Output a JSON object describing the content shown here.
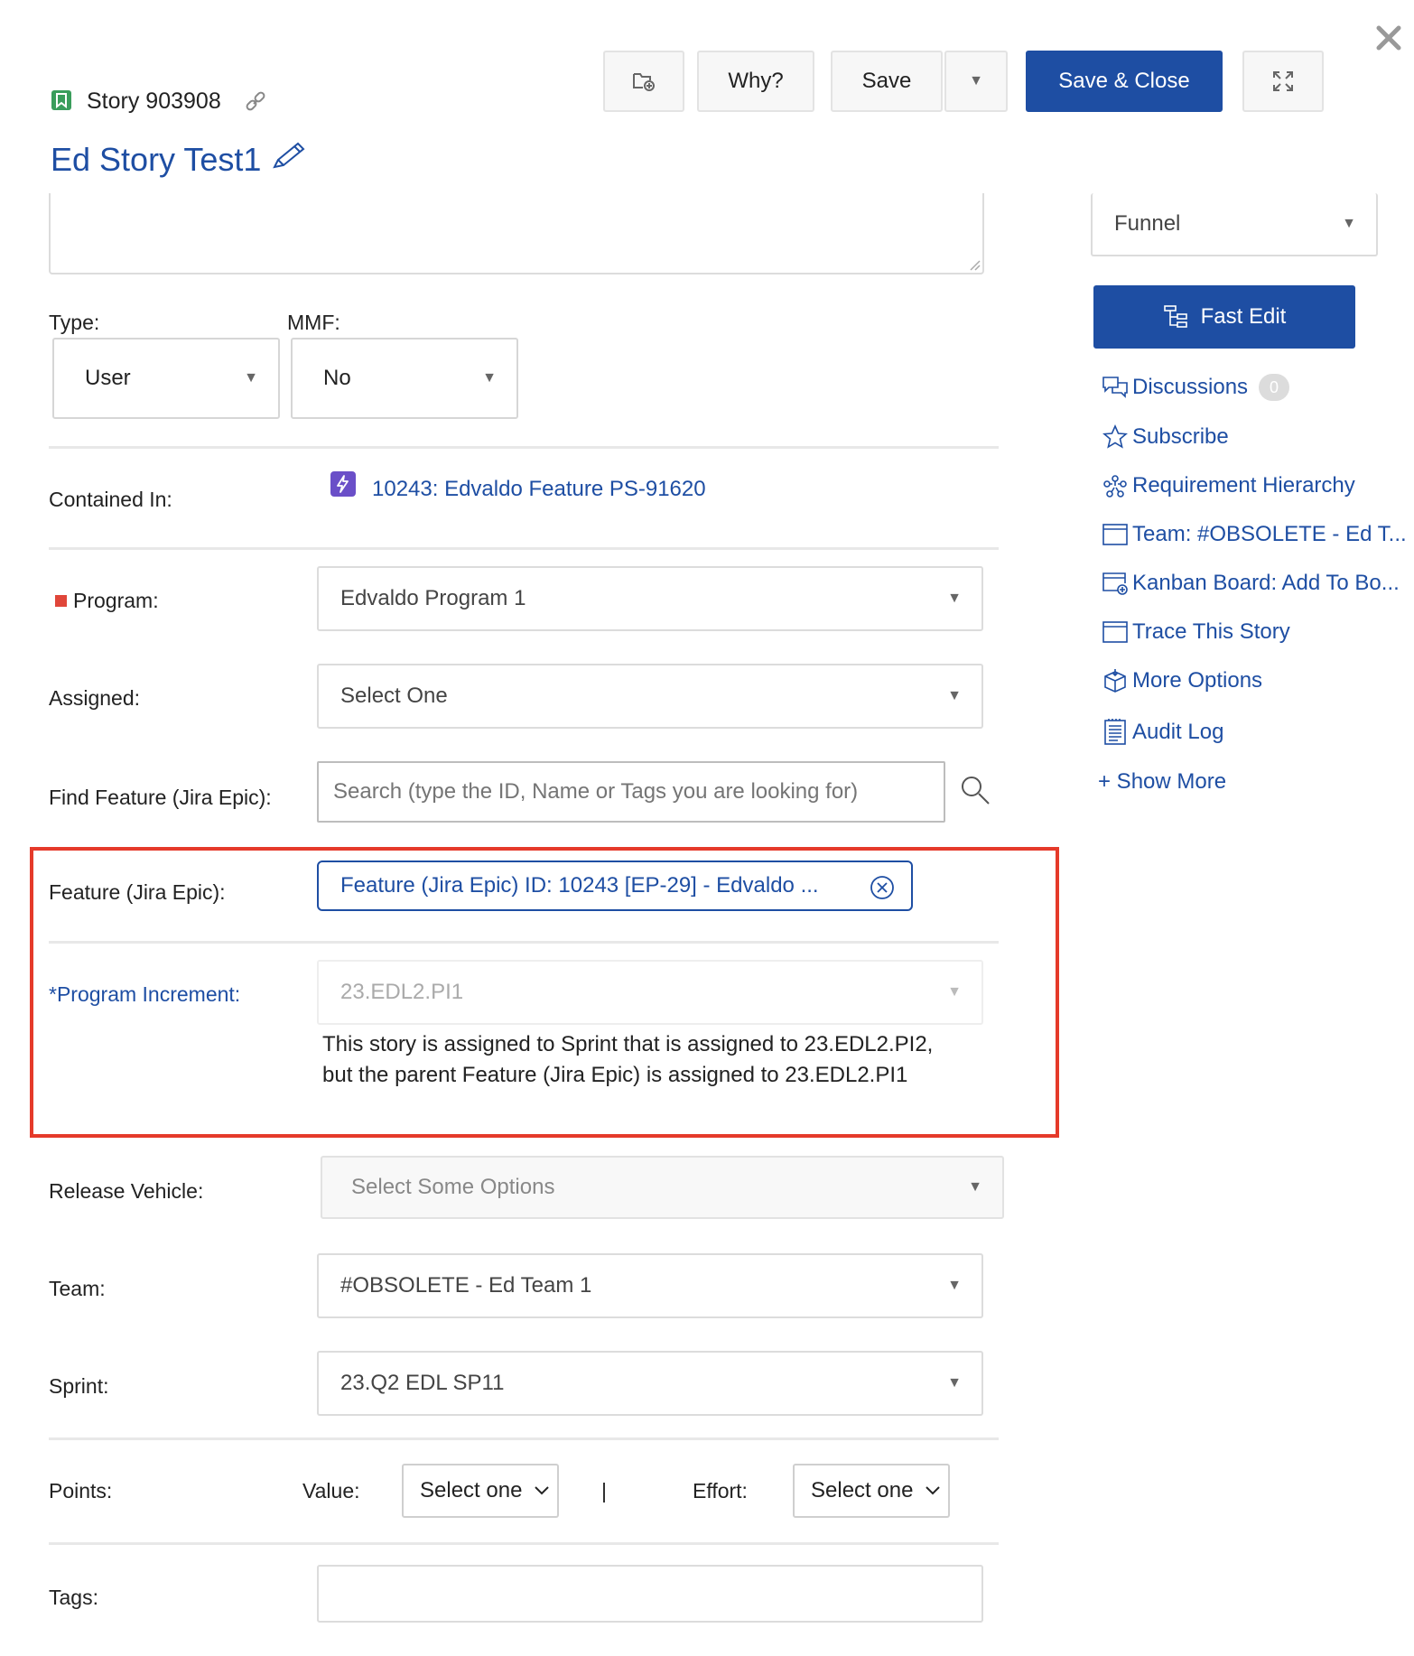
{
  "header": {
    "story_id": "Story 903908",
    "title": "Ed Story Test1"
  },
  "toolbar": {
    "why_label": "Why?",
    "save_label": "Save",
    "save_close_label": "Save & Close"
  },
  "status": {
    "value": "Funnel"
  },
  "fast_edit_label": "Fast Edit",
  "sidebar": {
    "discussions": {
      "label": "Discussions",
      "count": "0"
    },
    "subscribe": "Subscribe",
    "requirement_hierarchy": "Requirement Hierarchy",
    "team": "Team: #OBSOLETE - Ed T...",
    "kanban": "Kanban Board: Add To Bo...",
    "trace": "Trace This Story",
    "more_options": "More Options",
    "audit_log": "Audit Log",
    "show_more": "+ Show More"
  },
  "form": {
    "type_label": "Type:",
    "type_value": "User",
    "mmf_label": "MMF:",
    "mmf_value": "No",
    "contained_in_label": "Contained In:",
    "contained_in_value": "10243: Edvaldo Feature PS-91620",
    "program_label": "Program:",
    "program_value": "Edvaldo Program 1",
    "assigned_label": "Assigned:",
    "assigned_value": "Select One",
    "find_feature_label": "Find Feature (Jira Epic):",
    "find_feature_placeholder": "Search (type the ID, Name or Tags you are looking for)",
    "feature_label": "Feature (Jira Epic):",
    "feature_value": "Feature (Jira Epic) ID: 10243 [EP-29] - Edvaldo ...",
    "pi_label": "*Program Increment:",
    "pi_value": "23.EDL2.PI1",
    "pi_warning": "This story is assigned to Sprint that is assigned to 23.EDL2.PI2, but the parent Feature (Jira Epic) is assigned to 23.EDL2.PI1",
    "release_vehicle_label": "Release Vehicle:",
    "release_vehicle_placeholder": "Select Some Options",
    "team_label": "Team:",
    "team_value": "#OBSOLETE - Ed Team 1",
    "sprint_label": "Sprint:",
    "sprint_value": "23.Q2 EDL SP11",
    "points_label": "Points:",
    "value_label": "Value:",
    "value_select": "Select one",
    "separator": "|",
    "effort_label": "Effort:",
    "effort_select": "Select one",
    "tags_label": "Tags:"
  },
  "colors": {
    "accent": "#1e4ea3",
    "highlight_border": "#e53a2a",
    "required_marker": "#e0463a",
    "story_icon": "#3a9d5c",
    "feature_icon": "#6a4fc8"
  }
}
